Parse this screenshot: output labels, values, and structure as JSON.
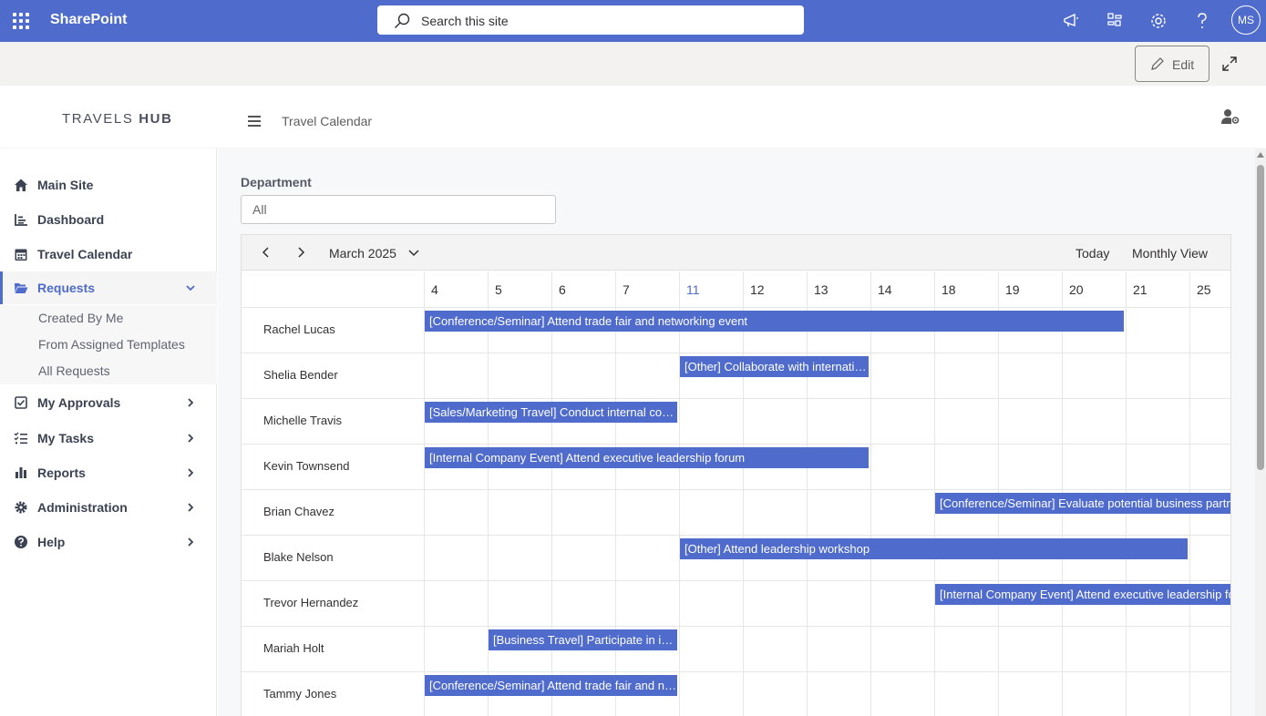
{
  "suite": {
    "app_name": "SharePoint",
    "search_placeholder": "Search this site",
    "avatar_initials": "MS"
  },
  "command_bar": {
    "edit_label": "Edit"
  },
  "app_header": {
    "logo_light": "TRAVELS ",
    "logo_bold": "HUB",
    "breadcrumb": "Travel Calendar"
  },
  "sidebar": {
    "items": [
      {
        "label": "Main Site",
        "icon": "home-icon"
      },
      {
        "label": "Dashboard",
        "icon": "chart-icon"
      },
      {
        "label": "Travel Calendar",
        "icon": "calendar-icon"
      },
      {
        "label": "Requests",
        "icon": "folder-open-icon",
        "expanded": true
      },
      {
        "label": "My Approvals",
        "icon": "check-square-icon"
      },
      {
        "label": "My Tasks",
        "icon": "task-list-icon"
      },
      {
        "label": "Reports",
        "icon": "bar-chart-icon"
      },
      {
        "label": "Administration",
        "icon": "gear-icon"
      },
      {
        "label": "Help",
        "icon": "help-icon"
      }
    ],
    "requests_sub": [
      "Created By Me",
      "From Assigned Templates",
      "All Requests"
    ]
  },
  "filter": {
    "department_label": "Department",
    "department_value": "All"
  },
  "calendar": {
    "month_label": "March 2025",
    "today_label": "Today",
    "view_label": "Monthly View",
    "days": [
      "4",
      "5",
      "6",
      "7",
      "11",
      "12",
      "13",
      "14",
      "18",
      "19",
      "20",
      "21",
      "25"
    ],
    "today_day": "11",
    "rows": [
      {
        "person": "Rachel Lucas",
        "events": [
          {
            "title": "[Conference/Seminar] Attend trade fair and networking event",
            "start": 0,
            "span": 11
          }
        ]
      },
      {
        "person": "Shelia Bender",
        "events": [
          {
            "title": "[Other] Collaborate with international partners",
            "start": 4,
            "span": 3
          }
        ]
      },
      {
        "person": "Michelle Travis",
        "events": [
          {
            "title": "[Sales/Marketing Travel] Conduct internal compliance audit",
            "start": 0,
            "span": 4
          }
        ]
      },
      {
        "person": "Kevin Townsend",
        "events": [
          {
            "title": "[Internal Company Event] Attend executive leadership forum",
            "start": 0,
            "span": 7
          }
        ]
      },
      {
        "person": "Brian Chavez",
        "events": [
          {
            "title": "[Conference/Seminar] Evaluate potential business partners",
            "start": 8,
            "span": 6
          }
        ]
      },
      {
        "person": "Blake Nelson",
        "events": [
          {
            "title": "[Other] Attend leadership workshop",
            "start": 4,
            "span": 8
          }
        ]
      },
      {
        "person": "Trevor Hernandez",
        "events": [
          {
            "title": "[Internal Company Event] Attend executive leadership forum",
            "start": 8,
            "span": 6
          }
        ]
      },
      {
        "person": "Mariah Holt",
        "events": [
          {
            "title": "[Business Travel] Participate in industry conference",
            "start": 1,
            "span": 3
          }
        ]
      },
      {
        "person": "Tammy Jones",
        "events": [
          {
            "title": "[Conference/Seminar] Attend trade fair and networking event",
            "start": 0,
            "span": 4
          }
        ]
      }
    ]
  },
  "colors": {
    "brand": "#4f6bcc",
    "event_bg": "#4f6bcc",
    "sidebar_text": "#3b4252"
  }
}
